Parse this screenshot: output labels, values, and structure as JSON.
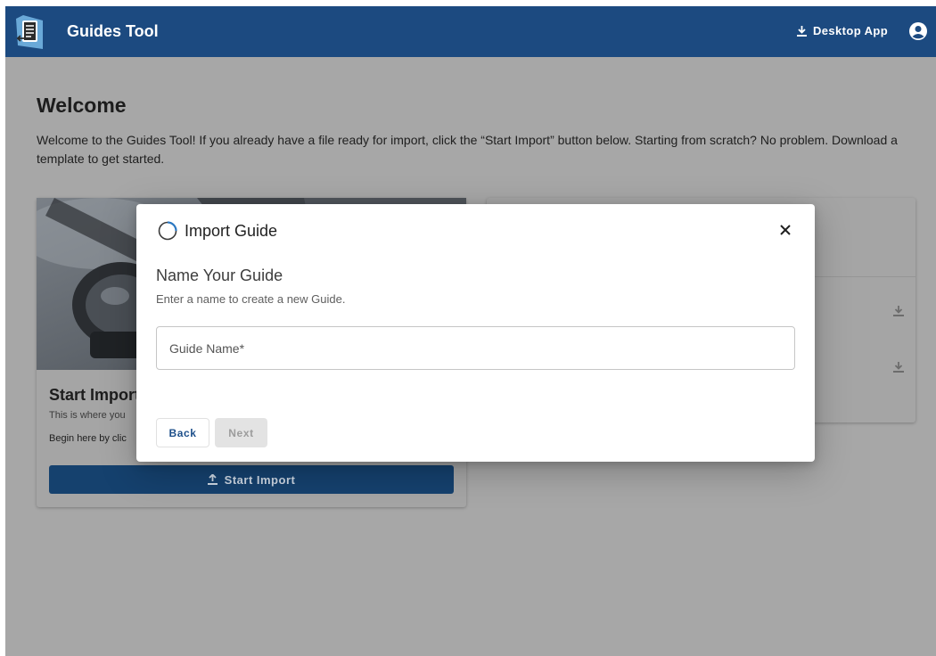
{
  "app": {
    "title": "Guides Tool",
    "desktop_app_label": "Desktop App"
  },
  "page": {
    "heading": "Welcome",
    "intro": "Welcome to the Guides Tool! If you already have a file ready for import, click the “Start Import” button below. Starting from scratch? No problem. Download a template to get started."
  },
  "start_card": {
    "title": "Start Import",
    "subtitle": "This is where you",
    "body": "Begin here by clic",
    "button_label": "Start Import"
  },
  "dialog": {
    "title": "Import Guide",
    "heading": "Name Your Guide",
    "description": "Enter a name to create a new Guide.",
    "field_placeholder": "Guide Name*",
    "field_value": "",
    "back_label": "Back",
    "next_label": "Next"
  },
  "colors": {
    "appbar": "#1c4a80",
    "primary": "#1d4f8a",
    "overlay_bg": "#a7a7a7",
    "disabled": "#e3e3e3"
  },
  "icons": {
    "logo": "document-logo-icon",
    "desktop": "download-icon",
    "account": "account-circle-icon",
    "spinner": "loading-spinner-icon",
    "close": "close-icon",
    "upload": "upload-icon"
  }
}
